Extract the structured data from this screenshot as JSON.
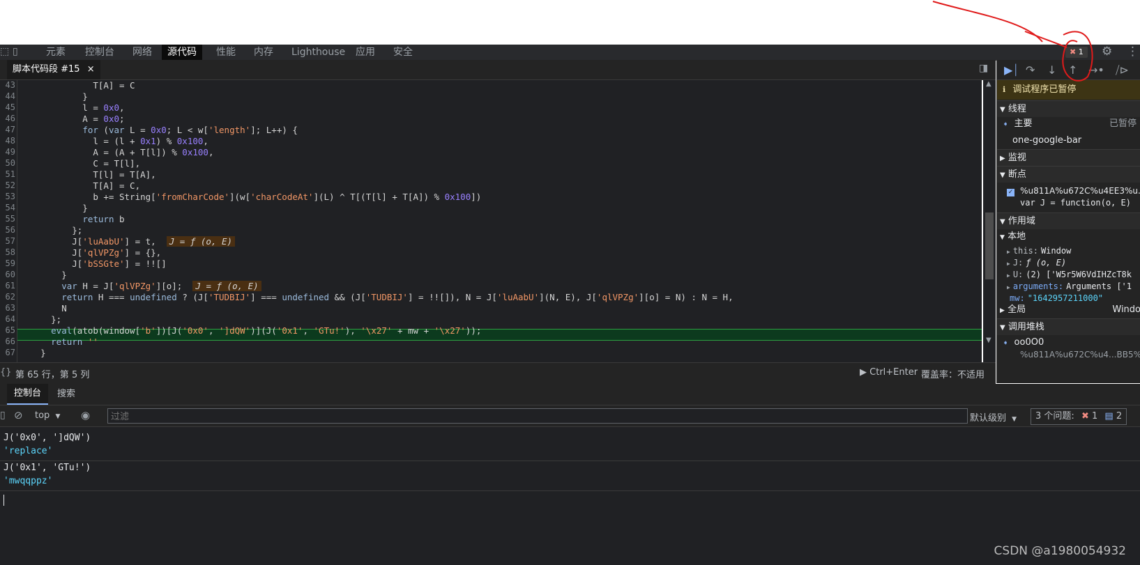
{
  "main_tabs": [
    "元素",
    "控制台",
    "网络",
    "源代码",
    "性能",
    "内存",
    "Lighthouse",
    "应用",
    "安全"
  ],
  "main_tabs_active": "源代码",
  "error_badge": "1",
  "source_tab": {
    "label": "脚本代码段 #15",
    "close": "×"
  },
  "code": {
    "line_numbers": [
      "43",
      "44",
      "45",
      "46",
      "47",
      "48",
      "49",
      "50",
      "51",
      "52",
      "53",
      "54",
      "55",
      "56",
      "57",
      "58",
      "59",
      "60",
      "61",
      "62",
      "63",
      "64",
      "65",
      "66",
      "67"
    ],
    "inline_values": {
      "l57": "J = ƒ (o, E)",
      "l61": "J = ƒ (o, E)"
    }
  },
  "status_bar": {
    "position": "第 65 行，第 5 列",
    "run": "Ctrl+Enter",
    "coverage": "覆盖率：不适用"
  },
  "debugger": {
    "paused_banner": "调试程序已暂停",
    "threads_header": "线程",
    "thread_main": "主要",
    "thread_main_status": "已暂停",
    "thread_other": "one-google-bar",
    "watch_header": "监视",
    "breakpoints_header": "断点",
    "breakpoint_file": "%u811A%u672C%u4EE3%u...",
    "breakpoint_code": "var J = function(o, E)",
    "scope_header": "作用域",
    "scope_local": "本地",
    "scope_items": [
      {
        "key": "this:",
        "val": "Window"
      },
      {
        "key": "J:",
        "val": "ƒ (o, E)"
      },
      {
        "key": "U:",
        "val": "(2) ['W5r5W6VdIHZcT8k"
      },
      {
        "key": "arguments:",
        "val": "Arguments ['1"
      },
      {
        "key": "mw:",
        "val": "\"1642957211000\""
      }
    ],
    "scope_global": "全局",
    "scope_global_val": "Windo",
    "callstack_header": "调用堆栈",
    "callstack_fn": "oo0O0",
    "callstack_loc": "%u811A%u672C%u4...BB5%2"
  },
  "drawer_tabs": [
    "控制台",
    "搜索"
  ],
  "console_toolbar": {
    "context": "top",
    "filter_placeholder": "过滤",
    "level": "默认级别",
    "issues_label": "3 个问题:",
    "issues_errors": "1",
    "issues_info": "2"
  },
  "console_log": [
    {
      "input": "J('0x0', ']dQW')",
      "output": "'replace'"
    },
    {
      "input": "J('0x1', 'GTu!')",
      "output": "'mwqqppz'"
    }
  ],
  "watermark": "CSDN @a1980054932",
  "colors": {
    "accent": "#8ab4f8",
    "current_line": "#0c3a1e",
    "annotation": "#e01b1b"
  }
}
